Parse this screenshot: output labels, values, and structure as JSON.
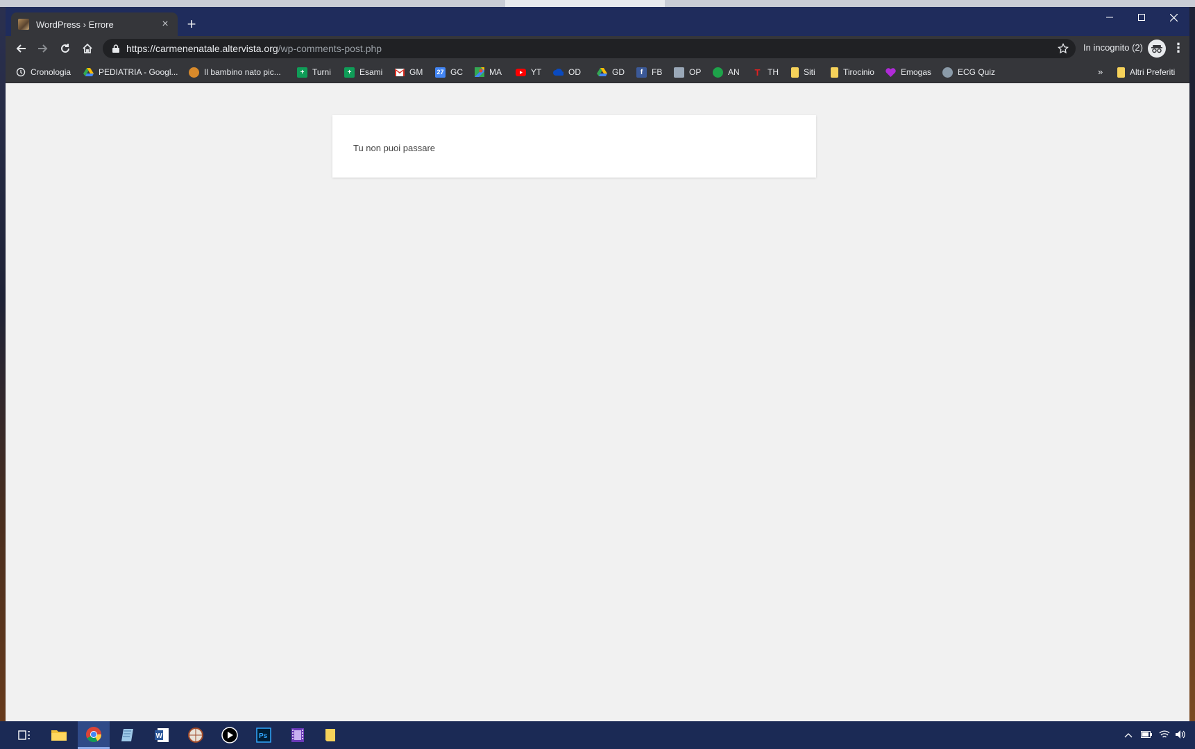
{
  "window": {
    "tab_title": "WordPress › Errore",
    "close_tab_symbol": "×",
    "new_tab_symbol": "+"
  },
  "toolbar": {
    "url_host": "https://carmenenatale.altervista.org",
    "url_path": "/wp-comments-post.php",
    "incognito_label": "In incognito (2)",
    "menu_symbol": "⋮"
  },
  "bookmarks": {
    "items": [
      {
        "label": "Cronologia",
        "icon": "history-icon"
      },
      {
        "label": "PEDIATRIA - Googl...",
        "icon": "drive-icon"
      },
      {
        "label": "Il bambino nato pic...",
        "icon": "site-icon"
      },
      {
        "label": "Turni",
        "icon": "sheets-icon"
      },
      {
        "label": "Esami",
        "icon": "sheets-icon"
      },
      {
        "label": "GM",
        "icon": "gmail-icon"
      },
      {
        "label": "GC",
        "icon": "calendar-icon"
      },
      {
        "label": "MA",
        "icon": "maps-icon"
      },
      {
        "label": "YT",
        "icon": "youtube-icon"
      },
      {
        "label": "OD",
        "icon": "onedrive-icon"
      },
      {
        "label": "GD",
        "icon": "drive-icon"
      },
      {
        "label": "FB",
        "icon": "facebook-icon"
      },
      {
        "label": "OP",
        "icon": "site-icon"
      },
      {
        "label": "AN",
        "icon": "site-icon"
      },
      {
        "label": "TH",
        "icon": "site-icon"
      },
      {
        "label": "Siti",
        "icon": "folder-icon"
      },
      {
        "label": "Tirocinio",
        "icon": "folder-icon"
      },
      {
        "label": "Emogas",
        "icon": "heart-icon"
      },
      {
        "label": "ECG Quiz",
        "icon": "site-icon"
      }
    ],
    "overflow_symbol": "»",
    "other_bookmarks": "Altri Preferiti",
    "calendar_number": "27"
  },
  "page": {
    "error_message": "Tu non puoi passare",
    "background_color": "#f1f1f1"
  },
  "colors": {
    "titlebar": "#1f2c5c",
    "toolbar": "#35363a",
    "taskbar": "#1b2a55"
  }
}
